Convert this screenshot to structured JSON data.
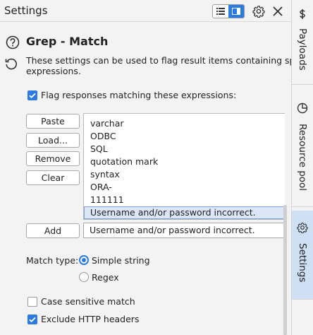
{
  "panel": {
    "title": "Settings",
    "view_toggle": [
      "list-view",
      "panel-view"
    ],
    "settings_icon": "gear-icon",
    "close_icon": "close-icon"
  },
  "section": {
    "title": "Grep - Match",
    "description_line1": "These settings can be used to flag result items containing specif",
    "description_line2": "expressions."
  },
  "flag_checkbox": {
    "label": "Flag responses matching these expressions:",
    "checked": true
  },
  "buttons": {
    "paste": "Paste",
    "load": "Load...",
    "remove": "Remove",
    "clear": "Clear",
    "add": "Add"
  },
  "expressions": [
    "varchar",
    "ODBC",
    "SQL",
    "quotation mark",
    "syntax",
    "ORA-",
    "111111",
    "Username and/or password incorrect."
  ],
  "selected_expression_index": 7,
  "new_expression_input": {
    "value": "Username and/or password incorrect."
  },
  "match_type": {
    "label": "Match type:",
    "options": [
      "Simple string",
      "Regex"
    ],
    "selected": "Simple string"
  },
  "case_sensitive": {
    "label": "Case sensitive match",
    "checked": false
  },
  "exclude_headers": {
    "label": "Exclude HTTP headers",
    "checked": true
  },
  "side_tabs": [
    {
      "label": "Payloads",
      "icon": "dollar-icon",
      "active": false
    },
    {
      "label": "Resource pool",
      "icon": "resource-pool-icon",
      "active": false
    },
    {
      "label": "Settings",
      "icon": "gear-icon",
      "active": true
    }
  ],
  "colors": {
    "accent": "#2c7be5",
    "selection": "#dbe6f7",
    "active_tab": "#cfdff4"
  }
}
